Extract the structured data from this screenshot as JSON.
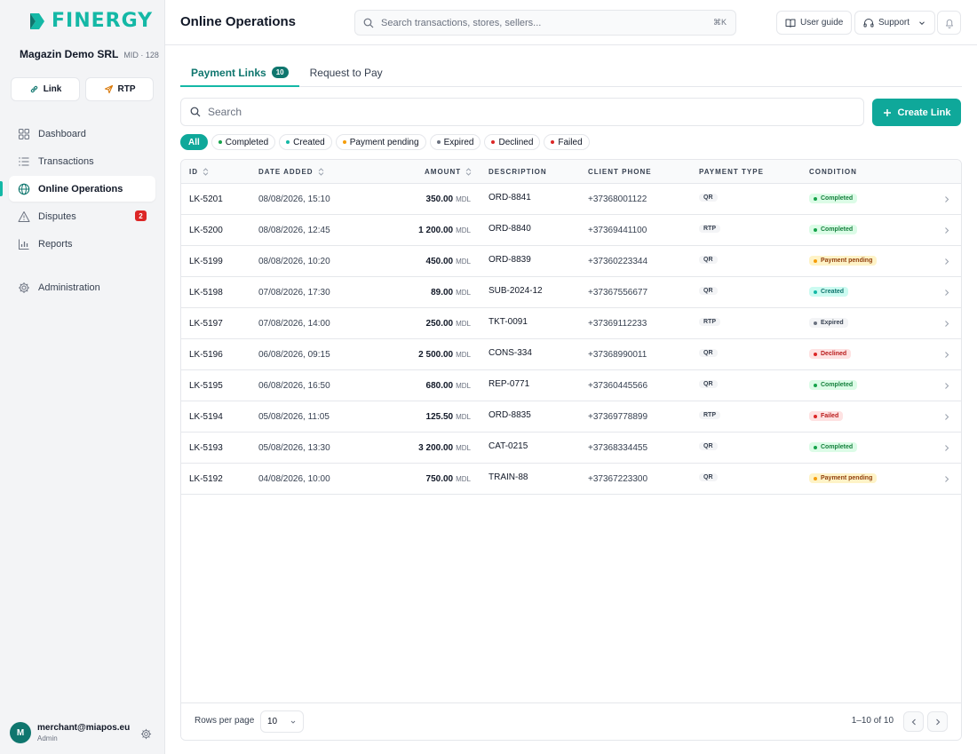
{
  "brand": {
    "name": "FINERGY",
    "accent": "#14b8a6"
  },
  "merchant": {
    "name": "Magazin Demo SRL",
    "mid": "MID · 128"
  },
  "quick_actions": {
    "link_label": "Link",
    "rtp_label": "RTP"
  },
  "nav": {
    "dashboard": "Dashboard",
    "transactions": "Transactions",
    "online_operations": "Online Operations",
    "disputes": "Disputes",
    "disputes_badge": "2",
    "reports": "Reports",
    "administration": "Administration"
  },
  "user": {
    "initial": "M",
    "email": "merchant@miapos.eu",
    "role": "Admin"
  },
  "header": {
    "title": "Online Operations",
    "search_placeholder": "Search transactions, stores, sellers...",
    "shortcut": "⌘K",
    "user_guide": "User guide",
    "support": "Support"
  },
  "tabs": {
    "payment_links": "Payment Links",
    "payment_links_count": "10",
    "request_to_pay": "Request to Pay"
  },
  "table_search_placeholder": "Search",
  "create_link_label": "Create Link",
  "filters": {
    "all": "All",
    "completed": "Completed",
    "created": "Created",
    "payment_pending": "Payment pending",
    "expired": "Expired",
    "declined": "Declined",
    "failed": "Failed"
  },
  "columns": {
    "id": "ID",
    "date": "DATE ADDED",
    "amount": "AMOUNT",
    "description": "DESCRIPTION",
    "phone": "CLIENT PHONE",
    "type": "PAYMENT TYPE",
    "condition": "CONDITION"
  },
  "status_styles": {
    "Completed": {
      "bg": "#dcfce7",
      "fg": "#15803d",
      "dot": "#16a34a"
    },
    "Created": {
      "bg": "#ccfbf1",
      "fg": "#0f766e",
      "dot": "#14b8a6"
    },
    "Payment pending": {
      "bg": "#fef3c7",
      "fg": "#92400e",
      "dot": "#f59e0b"
    },
    "Expired": {
      "bg": "#f3f4f6",
      "fg": "#374151",
      "dot": "#6b7280"
    },
    "Declined": {
      "bg": "#fee2e2",
      "fg": "#b91c1c",
      "dot": "#dc2626"
    },
    "Failed": {
      "bg": "#fee2e2",
      "fg": "#b91c1c",
      "dot": "#dc2626"
    }
  },
  "rows": [
    {
      "id": "LK-5201",
      "date": "08/08/2026, 15:10",
      "amount": "350.00",
      "currency": "MDL",
      "description": "ORD-8841",
      "phone": "+37368001122",
      "type": "QR",
      "condition": "Completed"
    },
    {
      "id": "LK-5200",
      "date": "08/08/2026, 12:45",
      "amount": "1 200.00",
      "currency": "MDL",
      "description": "ORD-8840",
      "phone": "+37369441100",
      "type": "RTP",
      "condition": "Completed"
    },
    {
      "id": "LK-5199",
      "date": "08/08/2026, 10:20",
      "amount": "450.00",
      "currency": "MDL",
      "description": "ORD-8839",
      "phone": "+37360223344",
      "type": "QR",
      "condition": "Payment pending"
    },
    {
      "id": "LK-5198",
      "date": "07/08/2026, 17:30",
      "amount": "89.00",
      "currency": "MDL",
      "description": "SUB-2024-12",
      "phone": "+37367556677",
      "type": "QR",
      "condition": "Created"
    },
    {
      "id": "LK-5197",
      "date": "07/08/2026, 14:00",
      "amount": "250.00",
      "currency": "MDL",
      "description": "TKT-0091",
      "phone": "+37369112233",
      "type": "RTP",
      "condition": "Expired"
    },
    {
      "id": "LK-5196",
      "date": "06/08/2026, 09:15",
      "amount": "2 500.00",
      "currency": "MDL",
      "description": "CONS-334",
      "phone": "+37368990011",
      "type": "QR",
      "condition": "Declined"
    },
    {
      "id": "LK-5195",
      "date": "06/08/2026, 16:50",
      "amount": "680.00",
      "currency": "MDL",
      "description": "REP-0771",
      "phone": "+37360445566",
      "type": "QR",
      "condition": "Completed"
    },
    {
      "id": "LK-5194",
      "date": "05/08/2026, 11:05",
      "amount": "125.50",
      "currency": "MDL",
      "description": "ORD-8835",
      "phone": "+37369778899",
      "type": "RTP",
      "condition": "Failed"
    },
    {
      "id": "LK-5193",
      "date": "05/08/2026, 13:30",
      "amount": "3 200.00",
      "currency": "MDL",
      "description": "CAT-0215",
      "phone": "+37368334455",
      "type": "QR",
      "condition": "Completed"
    },
    {
      "id": "LK-5192",
      "date": "04/08/2026, 10:00",
      "amount": "750.00",
      "currency": "MDL",
      "description": "TRAIN-88",
      "phone": "+37367223300",
      "type": "QR",
      "condition": "Payment pending"
    }
  ],
  "pagination": {
    "rows_per_page_label": "Rows per page",
    "rows_per_page": "10",
    "info": "1–10 of 10"
  }
}
